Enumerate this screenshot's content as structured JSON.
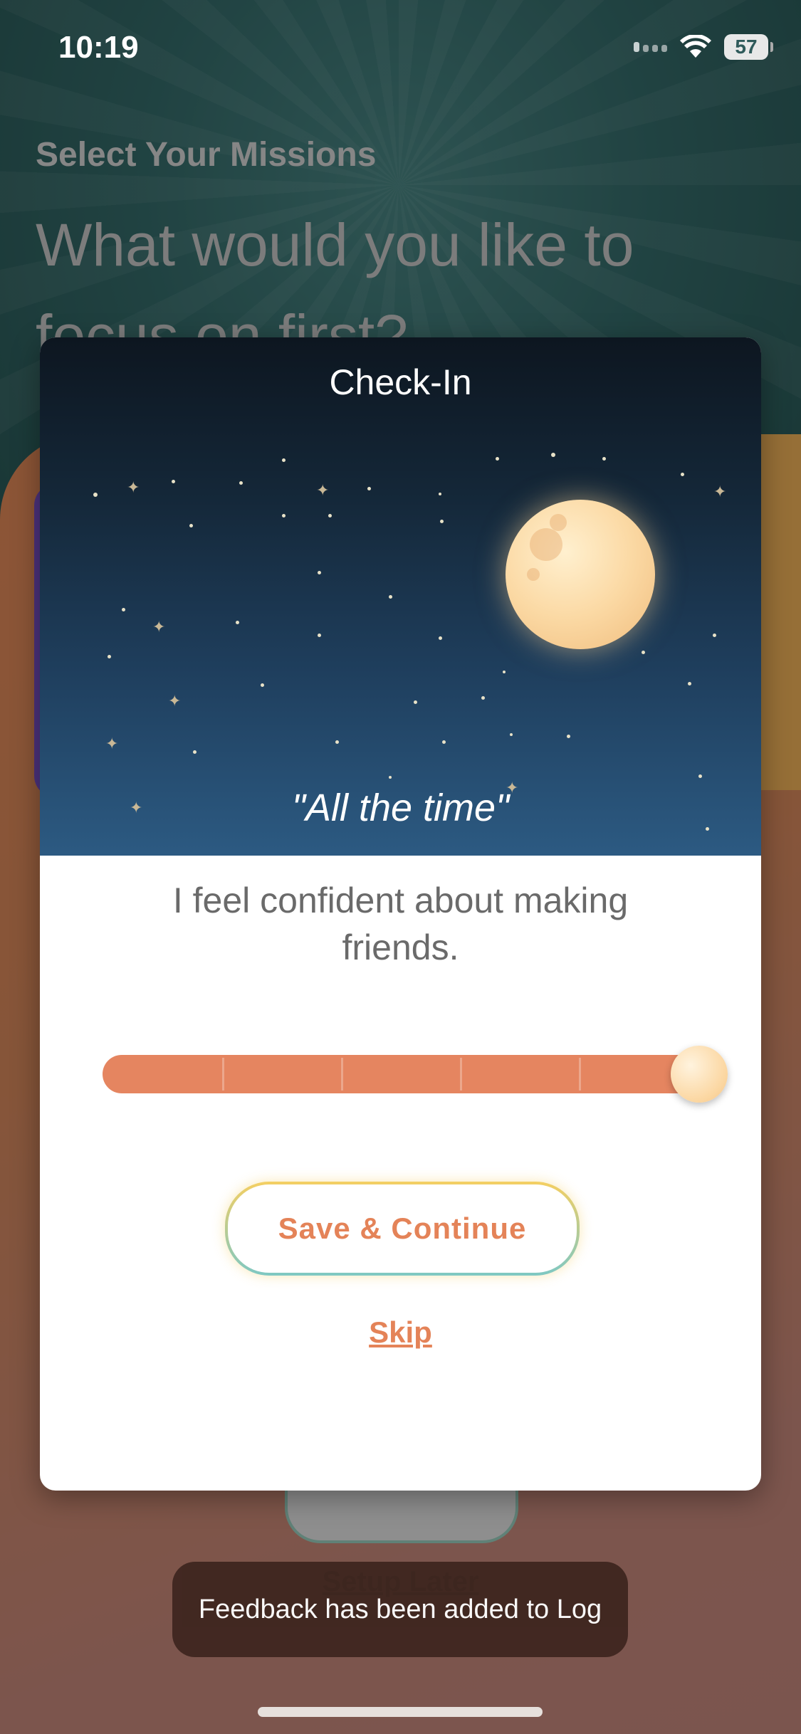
{
  "status_bar": {
    "time": "10:19",
    "battery": "57"
  },
  "background_screen": {
    "eyebrow": "Select Your Missions",
    "heading": "What would you like to focus on first?",
    "setup_later_label": "Setup Later"
  },
  "checkin_modal": {
    "title": "Check-In",
    "response_quote": "\"All the time\"",
    "question": "I feel confident about making friends.",
    "slider": {
      "steps": 6,
      "selected_step": 6,
      "fraction": 1.0
    },
    "save_label": "Save & Continue",
    "skip_label": "Skip"
  },
  "toast": {
    "message": "Feedback has been added to Log"
  },
  "colors": {
    "accent": "#e48358",
    "sky_top": "#0d1620",
    "sky_bottom": "#2c5a82",
    "moon": "#fbd9a4",
    "toast_bg": "#3f2720"
  }
}
